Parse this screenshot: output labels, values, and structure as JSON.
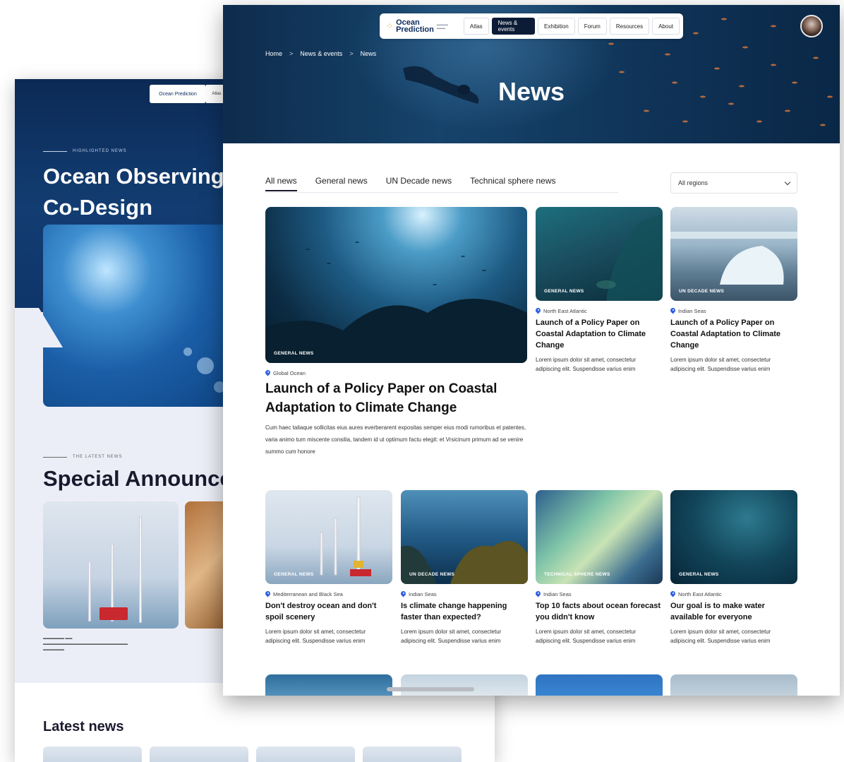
{
  "back_page": {
    "logo_text": "Ocean Prediction",
    "nav_label": "Atlas",
    "highlighted_label": "HIGHLIGHTED NEWS",
    "hero_title": "Ocean Observing Co-Design",
    "latest_label": "THE LATEST NEWS",
    "section_title": "Special Announcements",
    "latest_news_title": "Latest news"
  },
  "nav": {
    "logo_line1": "Ocean",
    "logo_line2": "Prediction",
    "items": [
      {
        "label": "Atlas"
      },
      {
        "label": "News & events"
      },
      {
        "label": "Exhibition"
      },
      {
        "label": "Forum"
      },
      {
        "label": "Resources"
      },
      {
        "label": "About"
      }
    ],
    "active_index": 1
  },
  "breadcrumb": [
    "Home",
    "News & events",
    "News"
  ],
  "page_title": "News",
  "tabs": [
    {
      "label": "All news"
    },
    {
      "label": "General news"
    },
    {
      "label": "UN Decade news"
    },
    {
      "label": "Technical sphere news"
    }
  ],
  "region_select": {
    "value": "All regions"
  },
  "featured": {
    "badge": "GENERAL NEWS",
    "location": "Global Ocean",
    "title": "Launch of a Policy Paper on Coastal Adaptation to Climate Change",
    "text": "Cum haec taliaque sollicitas eius aures everberarent expositas semper eius modi rumoribus et patentes, varia animo tum miscente consilia, tandem id ut optimum factu elegit: et Vrsicinum primum ad se venire summo cum honore"
  },
  "cards_top": [
    {
      "badge": "GENERAL NEWS",
      "location": "North East Atlantic",
      "title": "Launch of a Policy Paper on Coastal Adaptation to Climate Change",
      "text": "Lorem ipsum dolor sit amet, consectetur adipiscing elit. Suspendisse varius enim"
    },
    {
      "badge": "UN DECADE NEWS",
      "location": "Indian Seas",
      "title": "Launch of a Policy Paper on Coastal Adaptation to Climate Change",
      "text": "Lorem ipsum dolor sit amet, consectetur adipiscing elit. Suspendisse varius enim"
    }
  ],
  "cards_row": [
    {
      "badge": "GENERAL NEWS",
      "location": "Mediterranean and Black Sea",
      "title": "Don't destroy ocean and don't spoil scenery",
      "text": "Lorem ipsum dolor sit amet, consectetur adipiscing elit. Suspendisse varius enim"
    },
    {
      "badge": "UN DECADE NEWS",
      "location": "Indian Seas",
      "title": "Is climate change happening faster than expected?",
      "text": "Lorem ipsum dolor sit amet, consectetur adipiscing elit. Suspendisse varius enim"
    },
    {
      "badge": "TECHNICAL SPHERE NEWS",
      "location": "Indian Seas",
      "title": "Top 10 facts about ocean forecast you didn't know",
      "text": "Lorem ipsum dolor sit amet, consectetur adipiscing elit. Suspendisse varius enim"
    },
    {
      "badge": "GENERAL NEWS",
      "location": "North East Atlantic",
      "title": "Our goal is to make water available for everyone",
      "text": "Lorem ipsum dolor sit amet, consectetur adipiscing elit. Suspendisse varius enim"
    }
  ]
}
